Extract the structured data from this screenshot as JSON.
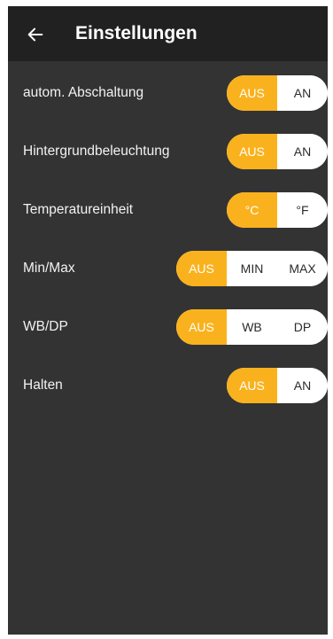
{
  "header": {
    "back_icon": "arrow-left-icon",
    "title": "Einstellungen"
  },
  "colors": {
    "background": "#333333",
    "header_background": "#212121",
    "accent": "#f9b21d",
    "segment_inactive": "#ffffff"
  },
  "settings": [
    {
      "label": "autom. Abschaltung",
      "options": [
        "AUS",
        "AN"
      ],
      "selected": "AUS"
    },
    {
      "label": "Hintergrundbeleuchtung",
      "options": [
        "AUS",
        "AN"
      ],
      "selected": "AUS"
    },
    {
      "label": "Temperatureinheit",
      "options": [
        "°C",
        "°F"
      ],
      "selected": "°C"
    },
    {
      "label": "Min/Max",
      "options": [
        "AUS",
        "MIN",
        "MAX"
      ],
      "selected": "AUS"
    },
    {
      "label": "WB/DP",
      "options": [
        "AUS",
        "WB",
        "DP"
      ],
      "selected": "AUS"
    },
    {
      "label": "Halten",
      "options": [
        "AUS",
        "AN"
      ],
      "selected": "AUS"
    }
  ]
}
